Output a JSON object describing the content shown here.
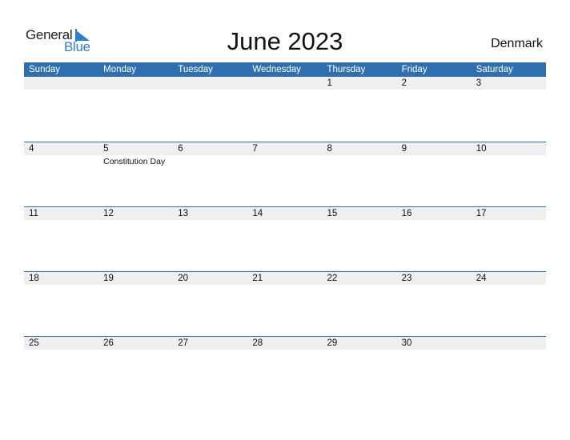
{
  "logo": {
    "line1": "General",
    "line2": "Blue",
    "icon": "triangle-flag-icon"
  },
  "title": "June 2023",
  "country": "Denmark",
  "colors": {
    "header": "#2e6fb0",
    "strip": "#efefef",
    "logo_blue": "#2a7fd4"
  },
  "weekdays": [
    "Sunday",
    "Monday",
    "Tuesday",
    "Wednesday",
    "Thursday",
    "Friday",
    "Saturday"
  ],
  "weeks": [
    {
      "days": [
        {
          "num": ""
        },
        {
          "num": ""
        },
        {
          "num": ""
        },
        {
          "num": ""
        },
        {
          "num": "1"
        },
        {
          "num": "2"
        },
        {
          "num": "3"
        }
      ]
    },
    {
      "days": [
        {
          "num": "4"
        },
        {
          "num": "5",
          "holiday": "Constitution Day"
        },
        {
          "num": "6"
        },
        {
          "num": "7"
        },
        {
          "num": "8"
        },
        {
          "num": "9"
        },
        {
          "num": "10"
        }
      ]
    },
    {
      "days": [
        {
          "num": "11"
        },
        {
          "num": "12"
        },
        {
          "num": "13"
        },
        {
          "num": "14"
        },
        {
          "num": "15"
        },
        {
          "num": "16"
        },
        {
          "num": "17"
        }
      ]
    },
    {
      "days": [
        {
          "num": "18"
        },
        {
          "num": "19"
        },
        {
          "num": "20"
        },
        {
          "num": "21"
        },
        {
          "num": "22"
        },
        {
          "num": "23"
        },
        {
          "num": "24"
        }
      ]
    },
    {
      "days": [
        {
          "num": "25"
        },
        {
          "num": "26"
        },
        {
          "num": "27"
        },
        {
          "num": "28"
        },
        {
          "num": "29"
        },
        {
          "num": "30"
        },
        {
          "num": ""
        }
      ]
    }
  ]
}
